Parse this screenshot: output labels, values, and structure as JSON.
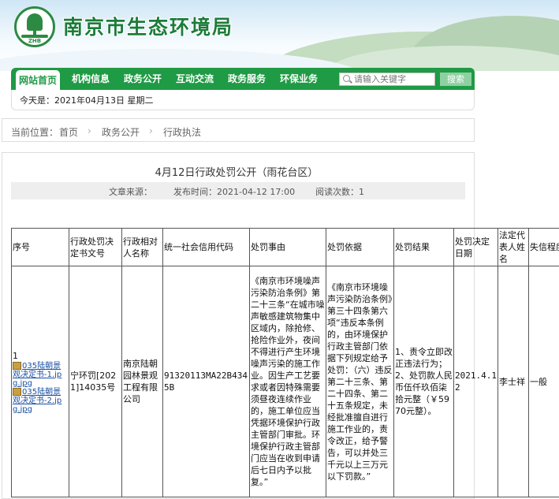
{
  "header": {
    "site_title": "南京市生态环境局",
    "logo_text": "ZHB"
  },
  "nav": {
    "items": [
      "网站首页",
      "机构信息",
      "政务公开",
      "互动交流",
      "政务服务",
      "环保业务"
    ],
    "search_placeholder": "请输入关键字",
    "search_button": "搜索"
  },
  "datebar": {
    "text": "今天是：2021年04月13日 星期二"
  },
  "breadcrumb": {
    "prefix": "当前位置：",
    "items": [
      "首页",
      "政务公开",
      "行政执法"
    ]
  },
  "article": {
    "title": "4月12日行政处罚公开（雨花台区）",
    "source": "文章来源：",
    "publish_time": "发布时间：2021-04-12 17:00",
    "reads": "阅读次数：1"
  },
  "table": {
    "headers": [
      "序号",
      "行政处罚决定书文号",
      "行政相对人名称",
      "统一社会信用代码",
      "处罚事由",
      "处罚依据",
      "处罚结果",
      "处罚决定日期",
      "法定代表人姓名",
      "失信程度"
    ],
    "row": {
      "seq": "1",
      "files": [
        "035陆朝景观决定书-1.jpg.jpg",
        "035陆朝景观决定书-2.jpg.jpg"
      ],
      "doc_no": "宁环罚[2021]14035号",
      "name": "南京陆朝园林景观工程有限公司",
      "credit_code": "91320113MA22B4345B",
      "reason": "《南京市环境噪声污染防治条例》第二十三条“在城市噪声敏感建筑物集中区域内，除抢修、抢险作业外，夜间不得进行产生环境噪声污染的施工作业。因生产工艺要求或者因特殊需要须昼夜连续作业的，施工单位应当凭据环境保护行政主管部门审批。环境保护行政主管部门应当在收到申请后七日内予以批复。”",
      "basis": "《南京市环境噪声污染防治条例》第三十四条第六项“违反本条例的，由环境保护行政主管部门依据下列规定给予处罚：（六）违反第二十三条、第二十四条、第二十五条规定，未经批准擅自进行施工作业的，责令改正，给予警告，可以并处三千元以上三万元以下罚款。”",
      "result": "1、责令立即改正违法行为；2、处罚款人民币伍仟玖佰柒拾元整（￥5970元整）。",
      "date": "2021.4.12",
      "legal_rep": "李士祥",
      "credit_level": "一般"
    }
  }
}
